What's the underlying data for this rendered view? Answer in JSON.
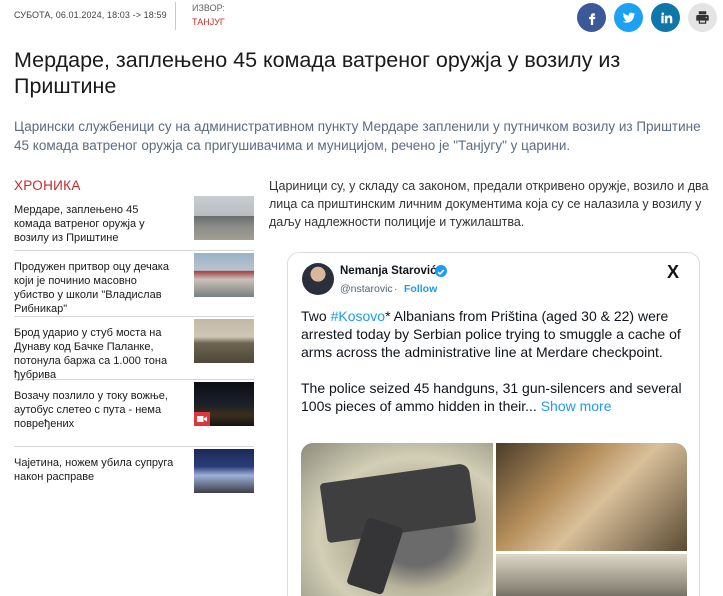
{
  "meta": {
    "date": "СУБОТА, 06.01.2024, 18:03 -> 18:59",
    "source_label": "ИЗВОР:",
    "source_name": "ТАНЈУГ"
  },
  "share": {
    "icons": [
      "facebook-icon",
      "twitter-icon",
      "linkedin-icon",
      "print-icon"
    ],
    "colors": {
      "facebook": "#3b5998",
      "twitter": "#1da1f2",
      "linkedin": "#0e76a8",
      "print": "#e4e4e4"
    }
  },
  "article": {
    "title": "Мердаре, заплењено 45 комада ватреног оружја у возилу из Приштине",
    "lead": "Царински службеници су на административном пункту Мердаре запленили у путничком возилу из Приштине 45 комада ватреног оружја са пригушивачима и муницијом, речено је \"Танјугу\" у царини.",
    "body": "Цариници су, у складу са законом, предали откривено оружје, возило и два лица са приштинским личним документима која су се налазила у возилу у даљу надлежности полиције и тужилаштва."
  },
  "sidebar": {
    "section": "ХРОНИКА",
    "items": [
      {
        "label": "Мердаре, заплењено 45 комада ватреног оружја у возилу из Приштине"
      },
      {
        "label": "Продужен притвор оцу дечака који је починио масовно убиство у школи \"Владислав Рибникар\""
      },
      {
        "label": "Брод ударио у стуб моста на Дунаву код Бачке Паланке, потонула баржа са 1.000 тона ђубрива"
      },
      {
        "label": "Возачу позлило у току вожње, аутобус слетео с пута - нема повређених"
      },
      {
        "label": "Чајетина, ножем убила супруга након расправе"
      }
    ]
  },
  "tweet": {
    "name": "Nemanja Starović",
    "handle": "@nstarovic",
    "dot": "·",
    "follow": "Follow",
    "x_logo": "X",
    "text_1": "Two ",
    "hashtag": "#Kosovo",
    "text_2": "* Albanians from Priština (aged 30 & 22) were arrested today by Serbian police trying to smuggle a cache of arms across the administrative line at Merdare checkpoint.",
    "text_3": "The police seized 45 handguns, 31 gun-silencers and several 100s pieces of ammo hidden in their...",
    "more": "Show more"
  }
}
